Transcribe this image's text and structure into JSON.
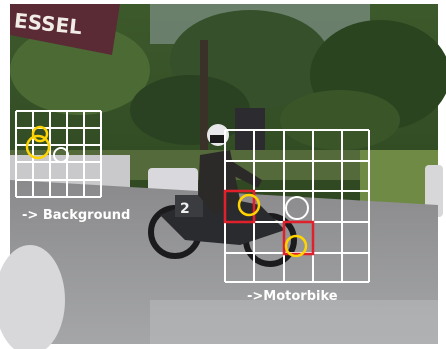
{
  "scene": {
    "banner_text": "ESSEL",
    "race_number": "2",
    "colors": {
      "grid_line": "#ffffff",
      "highlight_circle": "#ffd400",
      "highlight_box": "#e0202a",
      "road": "#8f9091",
      "foliage": "#2f4a22",
      "banner": "#5a2a35"
    }
  },
  "labels": {
    "background": "-> Background",
    "motorbike": "->Motorbike"
  }
}
